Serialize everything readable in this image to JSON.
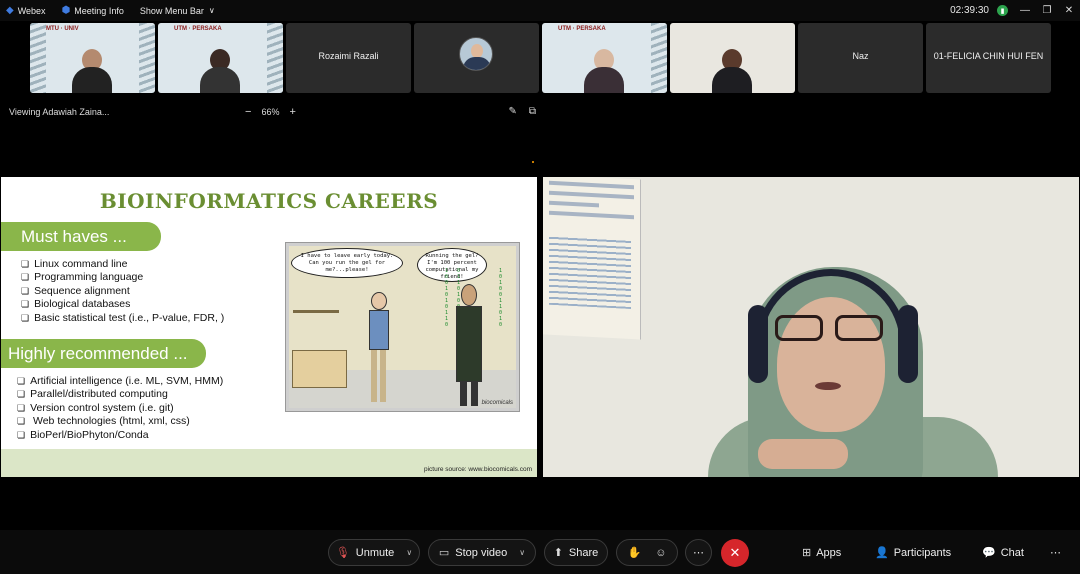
{
  "topbar": {
    "app": "Webex",
    "meeting_info": "Meeting Info",
    "show_menu": "Show Menu Bar",
    "time": "02:39:30"
  },
  "thumbnails": [
    {
      "label": "",
      "type": "video"
    },
    {
      "label": "",
      "type": "video"
    },
    {
      "label": "Rozaimi Razali",
      "type": "name"
    },
    {
      "label": "",
      "type": "avatar"
    },
    {
      "label": "",
      "type": "video"
    },
    {
      "label": "",
      "type": "video"
    },
    {
      "label": "Naz",
      "type": "name"
    },
    {
      "label": "01-FELICIA CHIN HUI FEN",
      "type": "name"
    }
  ],
  "share": {
    "viewing": "Viewing Adawiah Zaina...",
    "zoom_out": "−",
    "zoom": "66%",
    "zoom_in": "+"
  },
  "slide": {
    "title": "BIOINFORMATICS CAREERS",
    "must_haves_heading": "Must haves ...",
    "must_haves": [
      "Linux command line",
      "Programming language",
      "Sequence alignment",
      "Biological databases",
      "Basic statistical test (i.e., P-value, FDR, )"
    ],
    "recommended_heading": "Highly recommended ...",
    "recommended": [
      "Artificial intelligence (i.e. ML, SVM, HMM)",
      "Parallel/distributed computing",
      "Version control system (i.e. git)",
      " Web technologies (html, xml, css)",
      "BioPerl/BioPhyton/Conda"
    ],
    "source": "picture source: www.biocomicals.com",
    "comic_bubble_1": "I have to leave early today. Can you run the gel for me?...please!",
    "comic_bubble_2": "Running the gel? I'm 100 percent computational my friend!"
  },
  "toolbar": {
    "unmute": "Unmute",
    "stop_video": "Stop video",
    "share": "Share",
    "apps": "Apps",
    "participants": "Participants",
    "chat": "Chat"
  }
}
